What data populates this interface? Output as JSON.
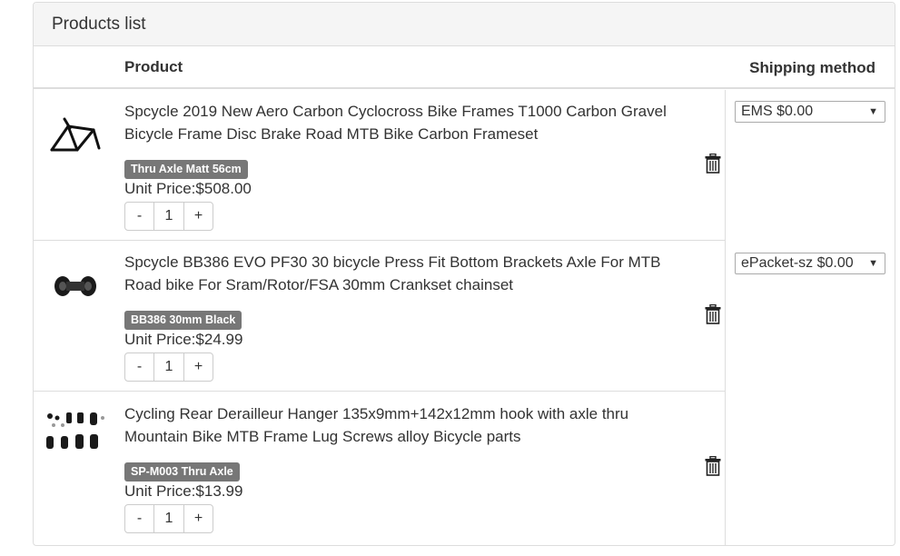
{
  "panel": {
    "title": "Products list"
  },
  "table": {
    "col_product": "Product",
    "col_shipping": "Shipping method"
  },
  "items": [
    {
      "title_line1": "Spcycle 2019 New Aero Carbon Cyclocross Bike Frames T1000 Carbon Gravel",
      "title_line2": "Bicycle Frame Disc Brake Road MTB Bike Carbon Frameset",
      "variant": "Thru Axle Matt 56cm",
      "unit_price": "Unit Price:$508.00",
      "qty_minus": "-",
      "qty": "1",
      "qty_plus": "+",
      "shipping": "EMS $0.00"
    },
    {
      "title_line1": "Spcycle BB386 EVO PF30 30 bicycle Press Fit Bottom Brackets Axle For MTB",
      "title_line2": "Road bike For Sram/Rotor/FSA 30mm Crankset chainset",
      "variant": "BB386 30mm Black",
      "unit_price": "Unit Price:$24.99",
      "qty_minus": "-",
      "qty": "1",
      "qty_plus": "+",
      "shipping": "ePacket-sz $0.00"
    },
    {
      "title_line1": "Cycling Rear Derailleur Hanger 135x9mm+142x12mm hook with axle thru",
      "title_line2": "Mountain Bike MTB Frame Lug Screws alloy Bicycle parts",
      "variant": "SP-M003 Thru Axle",
      "unit_price": "Unit Price:$13.99",
      "qty_minus": "-",
      "qty": "1",
      "qty_plus": "+"
    }
  ],
  "icons": {
    "delete": "trash-icon",
    "dropdown": "caret-down-icon"
  }
}
